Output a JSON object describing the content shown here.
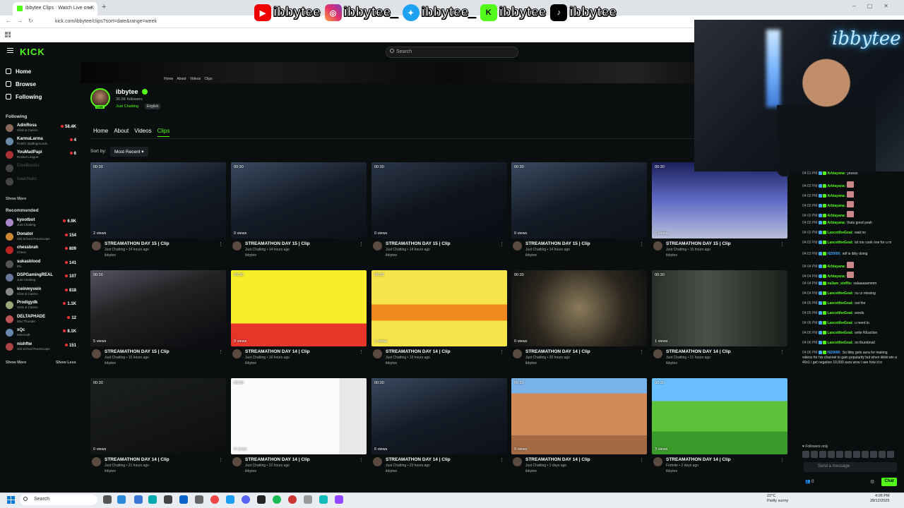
{
  "browser": {
    "tab_title": "ibbytee Clips · Watch Live on K",
    "url": "kick.com/ibbytee/clips?sort=date&range=week"
  },
  "overlay": {
    "handles": [
      "ibbytee",
      "ibbytee_",
      "ibbytee_",
      "ibbytee",
      "ibbytee"
    ],
    "camera_sign": "ibbytee"
  },
  "kick": {
    "logo": "KICK",
    "search_placeholder": "Search",
    "nav": [
      "Home",
      "Browse",
      "Following"
    ],
    "following_heading": "Following",
    "following": [
      {
        "name": "AdinRoss",
        "category": "Slots & Casino",
        "viewers": "58.4K",
        "color": "#8a6a5a"
      },
      {
        "name": "KarmaLarma",
        "category": "PUBG: Battlegrounds",
        "viewers": "4",
        "color": "#6a8aa8"
      },
      {
        "name": "YouMadPapi",
        "category": "Rocket League",
        "viewers": "6",
        "color": "#a33"
      },
      {
        "name": "EreeBrooks",
        "category": "",
        "viewers": "",
        "color": "#444"
      },
      {
        "name": "IsaacNaks",
        "category": "",
        "viewers": "",
        "color": "#444"
      }
    ],
    "show_more_1": "Show More",
    "recommended_heading": "Recommended",
    "recommended": [
      {
        "name": "kyootbot",
        "category": "Just Chatting",
        "viewers": "6.9K",
        "color": "#a8c"
      },
      {
        "name": "Donator",
        "category": "Old School RuneScape",
        "viewers": "154",
        "color": "#c83"
      },
      {
        "name": "chessbrah",
        "category": "Chess",
        "viewers": "809",
        "color": "#b22"
      },
      {
        "name": "sukasblood",
        "category": "IRL",
        "viewers": "141",
        "color": "#555"
      },
      {
        "name": "DSPGamingREAL",
        "category": "Just Chatting",
        "viewers": "107",
        "color": "#679"
      },
      {
        "name": "iceinmyvein",
        "category": "Slots & Casino",
        "viewers": "818",
        "color": "#888"
      },
      {
        "name": "Prodigydk",
        "category": "Slots & Casino",
        "viewers": "1.1K",
        "color": "#9a7"
      },
      {
        "name": "DELTAPHADE",
        "category": "War Thunder",
        "viewers": "12",
        "color": "#b55"
      },
      {
        "name": "xQc",
        "category": "Minecraft",
        "viewers": "8.1K",
        "color": "#68a"
      },
      {
        "name": "nishftw",
        "category": "Old School RuneScape",
        "viewers": "151",
        "color": "#a44"
      }
    ],
    "show_more_2": "Show More",
    "show_less": "Show Less"
  },
  "channel": {
    "mini_nav": "Home About Videos Clips",
    "name": "ibbytee",
    "followers": "30.5K followers",
    "category": "Just Chatting",
    "language": "English",
    "live": "LIVE",
    "tabs": [
      "Home",
      "About",
      "Videos",
      "Clips"
    ],
    "sort_label": "Sort by:",
    "sort_value": "Most Recent"
  },
  "clips": [
    {
      "dur": "00:30",
      "views": "2 views",
      "title": "STREAMATHON DAY 15 | Clip",
      "meta": "Just Chatting • 14 hours ago",
      "user": "ibbytee",
      "bg": "linear-gradient(160deg,#3a4a60,#141b26 50%,#0c1018)"
    },
    {
      "dur": "00:30",
      "views": "0 views",
      "title": "STREAMATHON DAY 15 | Clip",
      "meta": "Just Chatting • 14 hours ago",
      "user": "ibbytee",
      "bg": "linear-gradient(160deg,#3a4a60,#141b26 50%,#0c1018)"
    },
    {
      "dur": "00:30",
      "views": "0 views",
      "title": "STREAMATHON DAY 15 | Clip",
      "meta": "Just Chatting • 14 hours ago",
      "user": "ibbytee",
      "bg": "linear-gradient(160deg,#2a3648,#0f141c 50%,#0a0d12)"
    },
    {
      "dur": "00:30",
      "views": "0 views",
      "title": "STREAMATHON DAY 15 | Clip",
      "meta": "Just Chatting • 14 hours ago",
      "user": "ibbytee",
      "bg": "linear-gradient(160deg,#3a4a60,#141b26 50%,#0c1018)"
    },
    {
      "dur": "00:30",
      "views": "0 views",
      "title": "STREAMATHON DAY 15 | Clip",
      "meta": "Just Chatting • 15 hours ago",
      "user": "ibbytee",
      "bg": "linear-gradient(180deg,#1a1f5a,#5f6bc8 50%,#b8bfd8)"
    },
    {
      "dur": "00:30",
      "views": "5 views",
      "title": "STREAMATHON DAY 15 | Clip",
      "meta": "Just Chatting • 15 hours ago",
      "user": "ibbytee",
      "bg": "linear-gradient(160deg,#556,#222 40%,#0a0a0f)"
    },
    {
      "dur": "00:30",
      "views": "0 views",
      "title": "STREAMATHON DAY 14 | Clip",
      "meta": "Just Chatting • 19 hours ago",
      "user": "ibbytee",
      "bg": "linear-gradient(180deg,#f7ee2a 0 70%,#e8352a 70%)"
    },
    {
      "dur": "00:30",
      "views": "1 views",
      "title": "STREAMATHON DAY 14 | Clip",
      "meta": "Just Chatting • 19 hours ago",
      "user": "ibbytee",
      "bg": "linear-gradient(180deg,#f7e44a 0 45%,#f08a1e 45% 66%,#f7e44a 66%)"
    },
    {
      "dur": "00:30",
      "views": "0 views",
      "title": "STREAMATHON DAY 14 | Clip",
      "meta": "Just Chatting • 20 hours ago",
      "user": "ibbytee",
      "bg": "radial-gradient(circle at 50% 50%,#8a7a5a,#2a261e 60%,#111)"
    },
    {
      "dur": "00:30",
      "views": "1 views",
      "title": "STREAMATHON DAY 14 | Clip",
      "meta": "Just Chatting • 21 hours ago",
      "user": "ibbytee",
      "bg": "linear-gradient(90deg,#2a2f2a,#4a5048 40%,#1c201c)"
    },
    {
      "dur": "00:30",
      "views": "0 views",
      "title": "STREAMATHON DAY 14 | Clip",
      "meta": "Just Chatting • 21 hours ago",
      "user": "ibbytee",
      "bg": "linear-gradient(160deg,#1c201c,#0c0e0c)"
    },
    {
      "dur": "00:30",
      "views": "0 views",
      "title": "STREAMATHON DAY 14 | Clip",
      "meta": "Just Chatting • 22 hours ago",
      "user": "ibbytee",
      "bg": "linear-gradient(90deg,#fafafa 0 80%,#e9e9e9 80%)"
    },
    {
      "dur": "00:30",
      "views": "6 views",
      "title": "STREAMATHON DAY 14 | Clip",
      "meta": "Just Chatting • 23 hours ago",
      "user": "ibbytee",
      "bg": "linear-gradient(160deg,#3a4a60,#141b26 50%,#0c1018)"
    },
    {
      "dur": "00:30",
      "views": "0 views",
      "title": "STREAMATHON DAY 14 | Clip",
      "meta": "Just Chatting • 2 days ago",
      "user": "ibbytee",
      "bg": "linear-gradient(180deg,#7ab3e8 0 20%,#d28a5a 20% 75%,#a46a44 75%)"
    },
    {
      "dur": "00:30",
      "views": "3 views",
      "title": "STREAMATHON DAY 14 | Clip",
      "meta": "Fortnite • 2 days ago",
      "user": "ibbytee",
      "bg": "linear-gradient(180deg,#6ac0ff 0 30%,#5ec23a 30% 70%,#3a9a2a 70%)"
    }
  ],
  "chat": {
    "messages": [
      {
        "time": "04:01 PM",
        "user": "Arbiayana:",
        "text": "yessss",
        "color": "#53fc18"
      },
      {
        "time": "04:02 PM",
        "user": "Arbiayana:",
        "text": "",
        "color": "#53fc18"
      },
      {
        "time": "04:02 PM",
        "user": "Arbiayana:",
        "text": "",
        "color": "#53fc18"
      },
      {
        "time": "04:02 PM",
        "user": "Arbiayana:",
        "text": "",
        "color": "#53fc18"
      },
      {
        "time": "04:02 PM",
        "user": "Arbiayana:",
        "text": "",
        "color": "#53fc18"
      },
      {
        "time": "04:02 PM",
        "user": "Arbiayana:",
        "text": "thats good yeah",
        "color": "#53fc18"
      },
      {
        "time": "04:02 PM",
        "user": "LancettheGoat:",
        "text": "wait no",
        "color": "#53fc18"
      },
      {
        "time": "04:02 PM",
        "user": "LancettheGoat:",
        "text": "let me cook one for u m",
        "color": "#53fc18"
      },
      {
        "time": "04:03 PM",
        "user": "HZ0000:",
        "text": "wtf is ibby doing",
        "color": "#3ea6ff"
      },
      {
        "time": "04:04 PM",
        "user": "Arbiayana:",
        "text": "",
        "color": "#53fc18"
      },
      {
        "time": "04:04 PM",
        "user": "Arbiayana:",
        "text": "",
        "color": "#53fc18"
      },
      {
        "time": "04:04 PM",
        "user": "na3am_steffis:",
        "text": "salaaaaammm",
        "color": "#53fc18"
      },
      {
        "time": "04:04 PM",
        "user": "LancettheGoat:",
        "text": "nu ur missing",
        "color": "#53fc18"
      },
      {
        "time": "04:05 PM",
        "user": "LancettheGoat:",
        "text": "out the",
        "color": "#53fc18"
      },
      {
        "time": "04:05 PM",
        "user": "LancettheGoat:",
        "text": "words",
        "color": "#53fc18"
      },
      {
        "time": "04:06 PM",
        "user": "LancettheGoat:",
        "text": "u need to",
        "color": "#53fc18"
      },
      {
        "time": "04:06 PM",
        "user": "LancettheGoat:",
        "text": "write REaction",
        "color": "#53fc18"
      },
      {
        "time": "04:06 PM",
        "user": "LancettheGoat:",
        "text": "on thumbnail",
        "color": "#53fc18"
      },
      {
        "time": "04:06 PM",
        "user": "HZ0000:",
        "text": "So ibby gets aura for making videos for his channel to gain popularity but when iiiiiiiii win a 40v1 i get negative 10,000 aura wow i see how it is",
        "color": "#3ea6ff"
      }
    ],
    "followers_only": "Followers only",
    "input_placeholder": "Send a message",
    "viewer_count": "0",
    "send_label": "Chat"
  },
  "taskbar": {
    "search": "Search",
    "weather_temp": "22°C",
    "weather_desc": "Partly sunny",
    "time": "4:06 PM",
    "date": "28/12/2025"
  }
}
